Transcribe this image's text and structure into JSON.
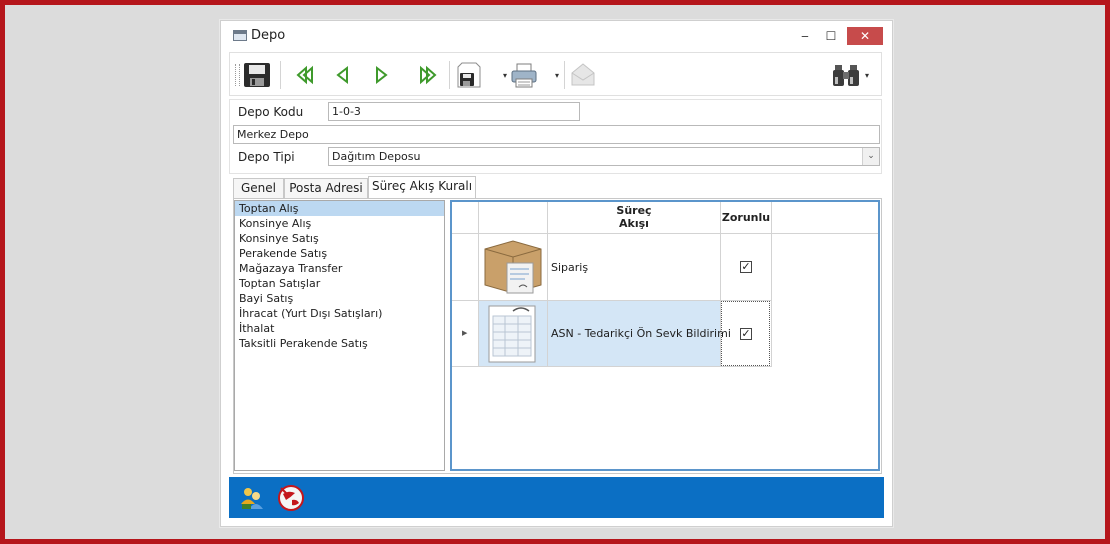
{
  "window": {
    "title": "Depo",
    "minimize_label": "‒",
    "maximize_label": "☐",
    "close_label": "✕"
  },
  "toolbar": {
    "items": [
      "save-icon",
      "first-record-icon",
      "previous-record-icon",
      "next-record-icon",
      "last-record-icon",
      "save-as-icon",
      "print-icon",
      "envelope-icon",
      "binoculars-icon"
    ],
    "dropdown_glyph": "▾"
  },
  "form": {
    "depo_kodu_label": "Depo Kodu",
    "depo_kodu_value": "1-0-3",
    "depo_adi_value": "Merkez Depo",
    "depo_tipi_label": "Depo Tipi",
    "depo_tipi_value": "Dağıtım Deposu",
    "select_arrow": "⌄"
  },
  "tabs": [
    {
      "label": "Genel"
    },
    {
      "label": "Posta Adresi"
    },
    {
      "label": "Süreç Akış Kuralı",
      "active": true
    }
  ],
  "process_list": [
    "Toptan Alış",
    "Konsinye Alış",
    "Konsinye Satış",
    "Perakende Satış",
    "Mağazaya Transfer",
    "Toptan Satışlar",
    "Bayi Satış",
    "İhracat (Yurt Dışı Satışları)",
    "İthalat",
    "Taksitli Perakende Satış"
  ],
  "grid": {
    "headers": {
      "flow_line1": "Süreç",
      "flow_line2": "Akışı",
      "required": "Zorunlu"
    },
    "rows": [
      {
        "icon": "box-icon",
        "label": "Sipariş",
        "required": true,
        "selected": false
      },
      {
        "icon": "document-icon",
        "label": "ASN - Tedarikçi Ön Sevk Bildirimi",
        "required": true,
        "selected": true
      }
    ],
    "checkmark": "✓",
    "row_pointer": "▶"
  },
  "statusbar": {
    "icons": [
      "users-icon",
      "globe-icon"
    ]
  },
  "colors": {
    "frame": "#b5161b",
    "statusbar": "#0b6fc4",
    "selection": "#bcd8f1",
    "grid_border": "#5b95cb",
    "close_button": "#c74b4b"
  }
}
